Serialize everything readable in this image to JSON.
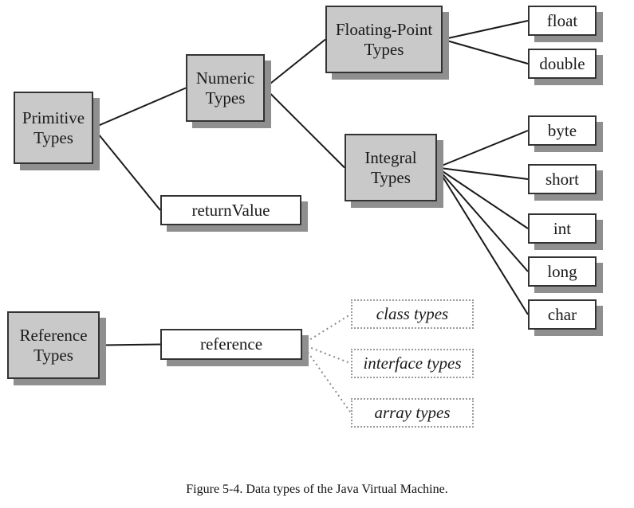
{
  "diagram": {
    "nodes": {
      "primitive": {
        "label": "Primitive\nTypes",
        "kind": "category"
      },
      "numeric": {
        "label": "Numeric\nTypes",
        "kind": "category"
      },
      "floating": {
        "label": "Floating-Point\nTypes",
        "kind": "category"
      },
      "integral": {
        "label": "Integral\nTypes",
        "kind": "category"
      },
      "float": {
        "label": "float",
        "kind": "leaf"
      },
      "double": {
        "label": "double",
        "kind": "leaf"
      },
      "byte": {
        "label": "byte",
        "kind": "leaf"
      },
      "short": {
        "label": "short",
        "kind": "leaf"
      },
      "int": {
        "label": "int",
        "kind": "leaf"
      },
      "long": {
        "label": "long",
        "kind": "leaf"
      },
      "char": {
        "label": "char",
        "kind": "leaf"
      },
      "returnValue": {
        "label": "returnValue",
        "kind": "leaf"
      },
      "referenceTypes": {
        "label": "Reference\nTypes",
        "kind": "category"
      },
      "reference": {
        "label": "reference",
        "kind": "leaf"
      },
      "classTypes": {
        "label": "class types",
        "kind": "dotted"
      },
      "interfaceTypes": {
        "label": "interface types",
        "kind": "dotted"
      },
      "arrayTypes": {
        "label": "array types",
        "kind": "dotted"
      }
    },
    "edges": [
      {
        "from": "primitive",
        "to": "numeric",
        "style": "solid"
      },
      {
        "from": "primitive",
        "to": "returnValue",
        "style": "solid"
      },
      {
        "from": "numeric",
        "to": "floating",
        "style": "solid"
      },
      {
        "from": "numeric",
        "to": "integral",
        "style": "solid"
      },
      {
        "from": "floating",
        "to": "float",
        "style": "solid"
      },
      {
        "from": "floating",
        "to": "double",
        "style": "solid"
      },
      {
        "from": "integral",
        "to": "byte",
        "style": "solid"
      },
      {
        "from": "integral",
        "to": "short",
        "style": "solid"
      },
      {
        "from": "integral",
        "to": "int",
        "style": "solid"
      },
      {
        "from": "integral",
        "to": "long",
        "style": "solid"
      },
      {
        "from": "integral",
        "to": "char",
        "style": "solid"
      },
      {
        "from": "referenceTypes",
        "to": "reference",
        "style": "solid"
      },
      {
        "from": "reference",
        "to": "classTypes",
        "style": "dotted"
      },
      {
        "from": "reference",
        "to": "interfaceTypes",
        "style": "dotted"
      },
      {
        "from": "reference",
        "to": "arrayTypes",
        "style": "dotted"
      }
    ]
  },
  "caption": "Figure 5-4. Data types of the Java Virtual Machine."
}
